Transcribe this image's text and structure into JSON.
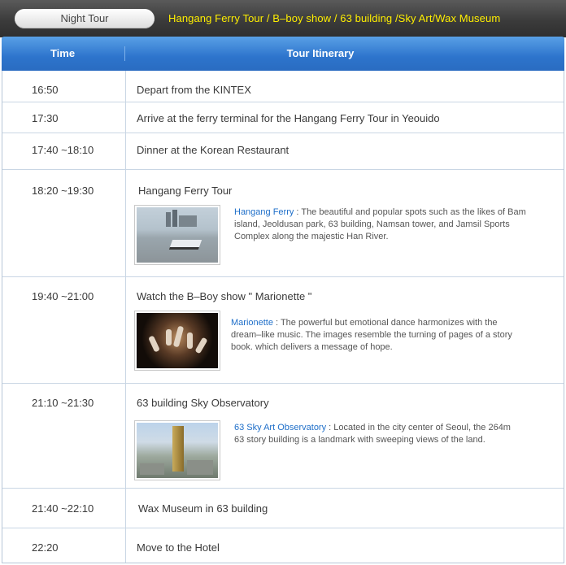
{
  "top": {
    "tab_label": "Night Tour",
    "title": "Hangang Ferry  Tour / B–boy show / 63 building /Sky Art/Wax Museum"
  },
  "header": {
    "time": "Time",
    "itinerary": "Tour  Itinerary"
  },
  "rows": [
    {
      "time": "16:50",
      "title": "Depart from the KINTEX"
    },
    {
      "time": "17:30",
      "title": "Arrive at the ferry terminal for the Hangang Ferry Tour in Yeouido"
    },
    {
      "time": "17:40 ~18:10",
      "title": "Dinner at the Korean Restaurant"
    },
    {
      "time": "18:20 ~19:30",
      "title": "Hangang Ferry Tour",
      "highlight": "Hangang Ferry",
      "desc_rest": " : The beautiful and popular spots such as the likes of Bam island, Jeoldusan park, 63 building, Namsan tower, and Jamsil Sports Complex along the majestic  Han River."
    },
    {
      "time": "19:40 ~21:00",
      "title": "Watch the B–Boy show \" Marionette \"",
      "highlight": "Marionette",
      "desc_rest": " : The powerful but emotional dance harmonizes with the dream–like music. The images resemble the turning of pages of a story book.  which  delivers a  message of hope."
    },
    {
      "time": "21:10 ~21:30",
      "title": "63 building Sky Observatory",
      "highlight": "63 Sky Art Observatory",
      "desc_rest": " : Located in the city center of Seoul, the 264m 63 story building is a landmark with sweeping views of the land."
    },
    {
      "time": "21:40 ~22:10",
      "title": "Wax Museum in 63 building"
    },
    {
      "time": "22:20",
      "title": "Move to the Hotel"
    }
  ],
  "colors": {
    "header_blue": "#2d74cc",
    "title_yellow": "#ffef00",
    "link_blue": "#1f6fc9"
  },
  "icons": {
    "ferry_photo": "ferry-photo",
    "bboy_photo": "bboy-photo",
    "tower_photo": "63-building-photo"
  }
}
